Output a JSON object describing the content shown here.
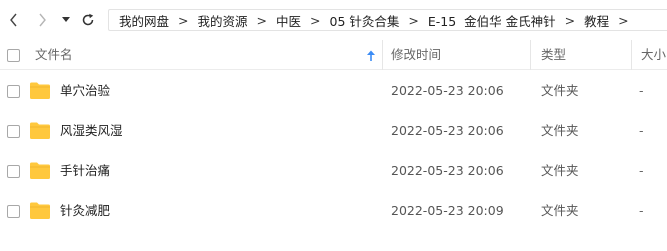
{
  "nav": {
    "icons": [
      "chevron-left-icon",
      "chevron-right-icon",
      "caret-down-icon",
      "refresh-icon"
    ]
  },
  "breadcrumb": {
    "separator": ">",
    "items": [
      "我的网盘",
      "我的资源",
      "中医",
      "05 针灸合集",
      "E-15  金伯华 金氏神针",
      "教程"
    ]
  },
  "columns": {
    "name": "文件名",
    "modified": "修改时间",
    "type": "类型",
    "size": "大小"
  },
  "files": [
    {
      "name": "单穴治验",
      "modified": "2022-05-23 20:06",
      "type": "文件夹",
      "size": "-"
    },
    {
      "name": "风湿类风湿",
      "modified": "2022-05-23 20:06",
      "type": "文件夹",
      "size": "-"
    },
    {
      "name": "手针治痛",
      "modified": "2022-05-23 20:06",
      "type": "文件夹",
      "size": "-"
    },
    {
      "name": "针灸减肥",
      "modified": "2022-05-23 20:09",
      "type": "文件夹",
      "size": "-"
    }
  ],
  "colors": {
    "folder": "#FFC83D",
    "sort_arrow": "#3B8CF5",
    "border": "#E3E3E3"
  }
}
